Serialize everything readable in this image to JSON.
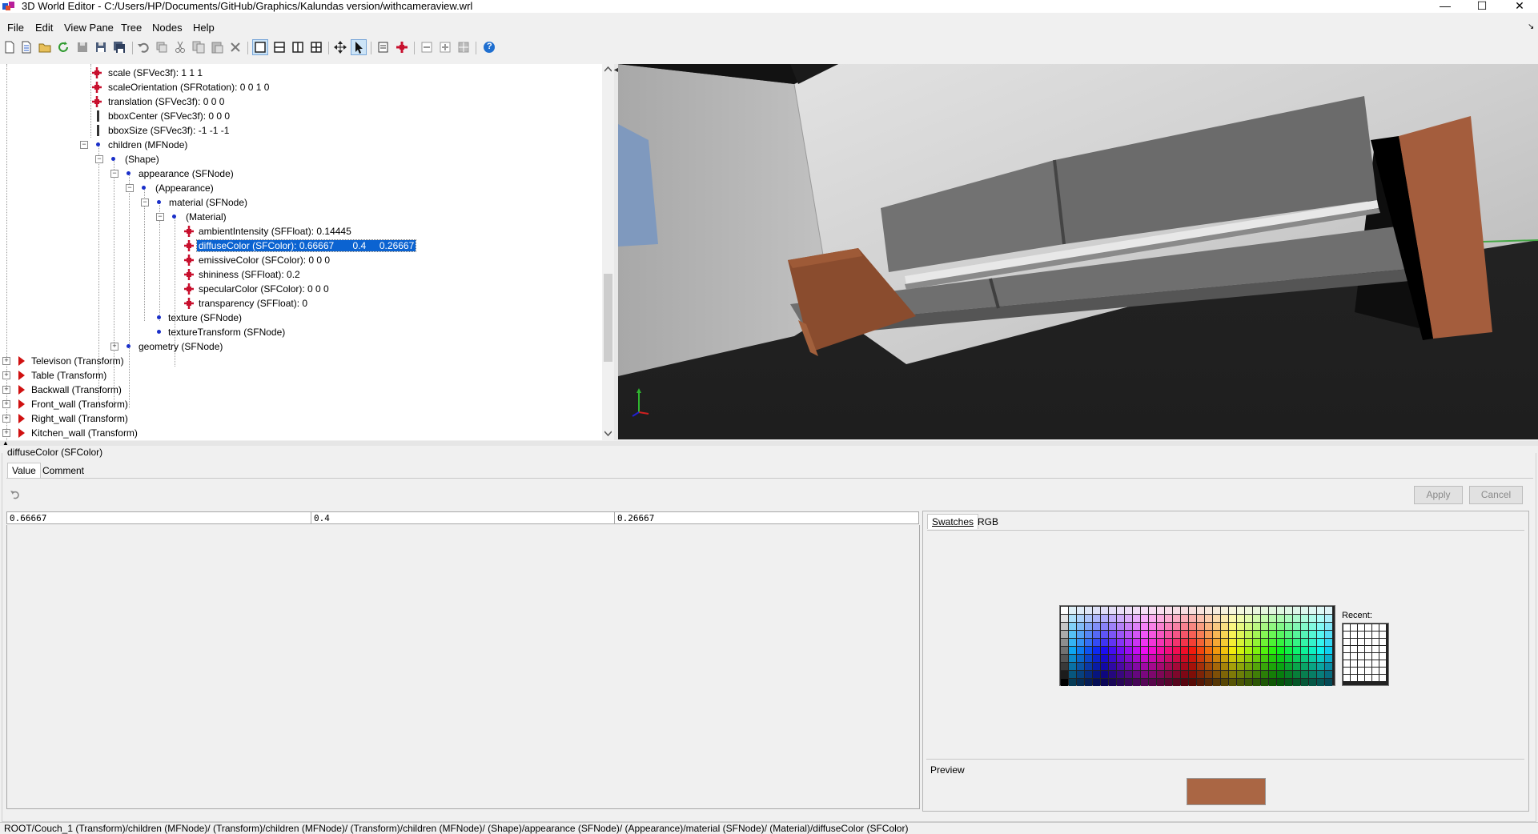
{
  "window": {
    "title": "3D World Editor - C:/Users/HP/Documents/GitHub/Graphics/Kalundas version/withcameraview.wrl",
    "minimize_glyph": "—",
    "maximize_glyph": "☐",
    "close_glyph": "✕"
  },
  "menu": [
    "File",
    "Edit",
    "View Pane",
    "Tree",
    "Nodes",
    "Help"
  ],
  "toolbar": {
    "icons": [
      "new-file-icon",
      "new-template-icon",
      "open-folder-icon",
      "reload-icon",
      "save-disabled-icon",
      "save-as-icon",
      "save-all-icon",
      "undo-icon",
      "redo-icon",
      "cut-icon",
      "copy-icon",
      "paste-icon",
      "delete-icon",
      "single-pane-icon",
      "split-horizontal-icon",
      "split-vertical-icon",
      "quad-pane-icon",
      "navigate-icon",
      "select-pointer-icon",
      "insert-node-icon",
      "move-node-icon",
      "zoom-out-icon",
      "zoom-in-icon",
      "zoom-fit-icon",
      "help-icon"
    ],
    "help_glyph": "?"
  },
  "tree": {
    "rows": [
      {
        "label": "scale (SFVec3f): 1  1  1"
      },
      {
        "label": "scaleOrientation (SFRotation): 0  0  1  0"
      },
      {
        "label": "translation (SFVec3f): 0  0  0"
      },
      {
        "label": "bboxCenter (SFVec3f): 0  0  0"
      },
      {
        "label": "bboxSize (SFVec3f): -1 -1 -1"
      },
      {
        "label": "children (MFNode)"
      },
      {
        "label": "(Shape)"
      },
      {
        "label": "appearance (SFNode)"
      },
      {
        "label": "(Appearance)"
      },
      {
        "label": "material (SFNode)"
      },
      {
        "label": "(Material)"
      },
      {
        "label": "ambientIntensity (SFFloat): 0.14445"
      },
      {
        "label": "diffuseColor (SFColor): 0.66667       0.4     0.26667"
      },
      {
        "label": "emissiveColor (SFColor): 0  0  0"
      },
      {
        "label": "shininess (SFFloat): 0.2"
      },
      {
        "label": "specularColor (SFColor): 0  0  0"
      },
      {
        "label": "transparency (SFFloat): 0"
      },
      {
        "label": "texture (SFNode)"
      },
      {
        "label": "textureTransform (SFNode)"
      },
      {
        "label": "geometry (SFNode)"
      },
      {
        "label": "Televison (Transform)"
      },
      {
        "label": "Table (Transform)"
      },
      {
        "label": "Backwall (Transform)"
      },
      {
        "label": "Front_wall (Transform)"
      },
      {
        "label": "Right_wall (Transform)"
      },
      {
        "label": "Kitchen_wall (Transform)"
      }
    ],
    "expand_plus": "+",
    "expand_minus": "−"
  },
  "editor": {
    "group_title": "diffuseColor (SFColor)",
    "tabs": [
      "Value",
      "Comment"
    ],
    "apply_label": "Apply",
    "cancel_label": "Cancel",
    "values": [
      "0.66667",
      "0.4",
      "0.26667"
    ],
    "color_tabs": [
      "Swatches",
      "RGB"
    ],
    "recent_label": "Recent:",
    "preview_label": "Preview",
    "preview_color": "#aa6644"
  },
  "status": {
    "path": "ROOT/Couch_1 (Transform)/children (MFNode)/ (Transform)/children (MFNode)/ (Transform)/children (MFNode)/ (Shape)/appearance (SFNode)/ (Appearance)/material (SFNode)/ (Material)/diffuseColor (SFColor)"
  }
}
